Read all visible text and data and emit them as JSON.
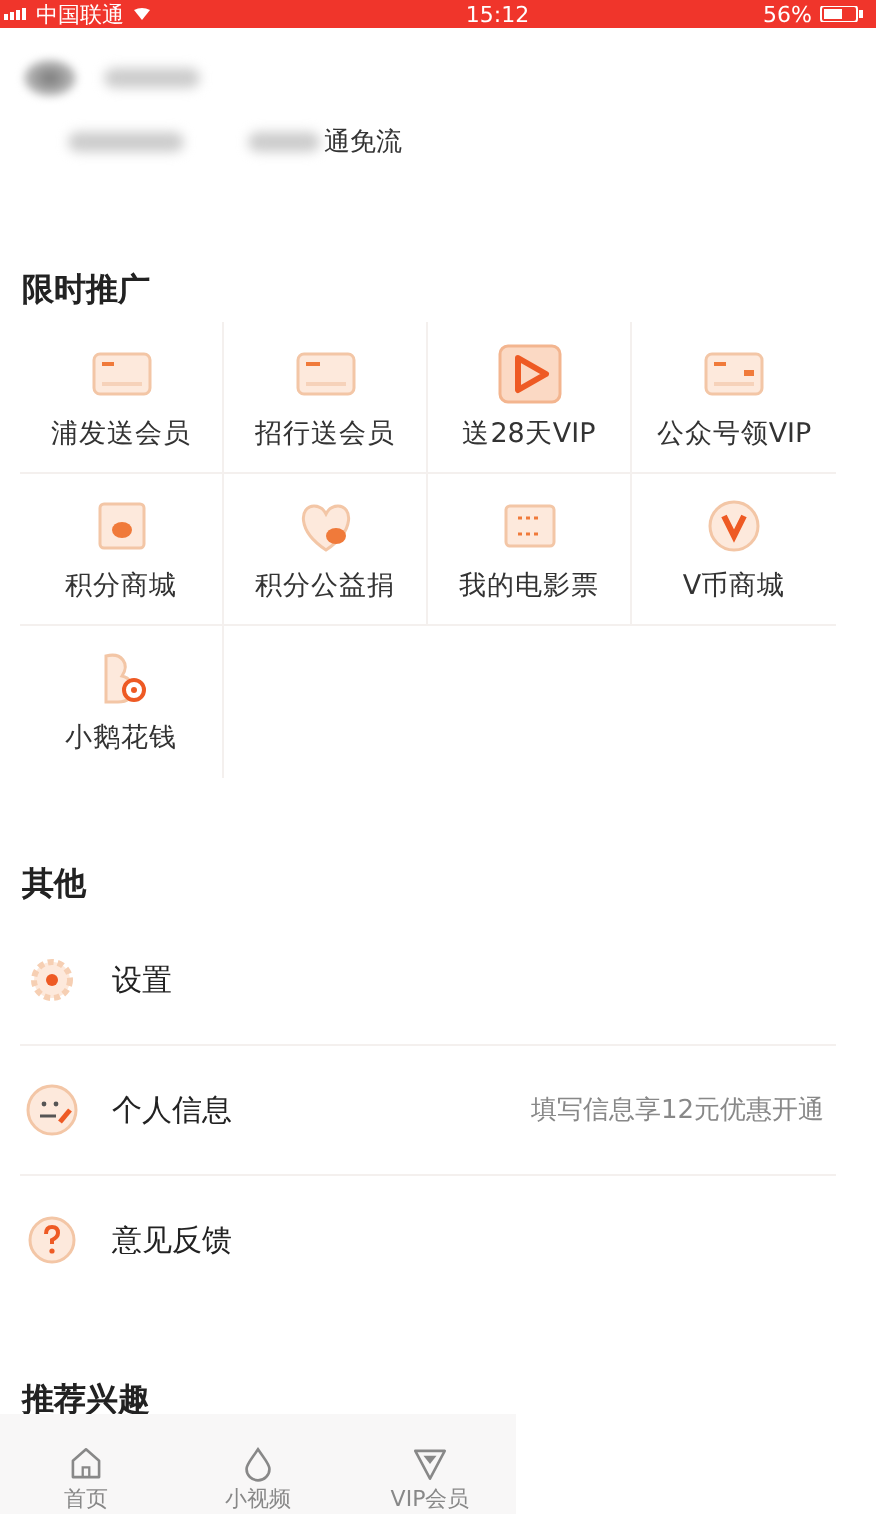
{
  "status_bar": {
    "carrier": "中国联通",
    "time": "15:12",
    "battery": "56%"
  },
  "profile": {
    "tag": "通免流"
  },
  "promo": {
    "title": "限时推广",
    "items": [
      {
        "label": "浦发送会员",
        "kind": "vipcard"
      },
      {
        "label": "招行送会员",
        "kind": "card"
      },
      {
        "label": "送28天VIP",
        "kind": "play"
      },
      {
        "label": "公众号领VIP",
        "kind": "vipcard3"
      },
      {
        "label": "积分商城",
        "kind": "shop"
      },
      {
        "label": "积分公益捐",
        "kind": "heart"
      },
      {
        "label": "我的电影票",
        "kind": "ticket"
      },
      {
        "label": "V币商城",
        "kind": "vcoin"
      },
      {
        "label": "小鹅花钱",
        "kind": "goose"
      }
    ]
  },
  "other": {
    "title": "其他",
    "items": [
      {
        "label": "设置",
        "kind": "gear"
      },
      {
        "label": "个人信息",
        "kind": "face",
        "hint": "填写信息享12元优惠开通"
      },
      {
        "label": "意见反馈",
        "kind": "question"
      }
    ]
  },
  "interests": {
    "title": "推荐兴趣"
  },
  "tab_bar": [
    {
      "label": "首页",
      "kind": "home",
      "selected": false
    },
    {
      "label": "小视频",
      "kind": "drop",
      "selected": false
    },
    {
      "label": "VIP会员",
      "kind": "vip",
      "selected": false
    }
  ]
}
